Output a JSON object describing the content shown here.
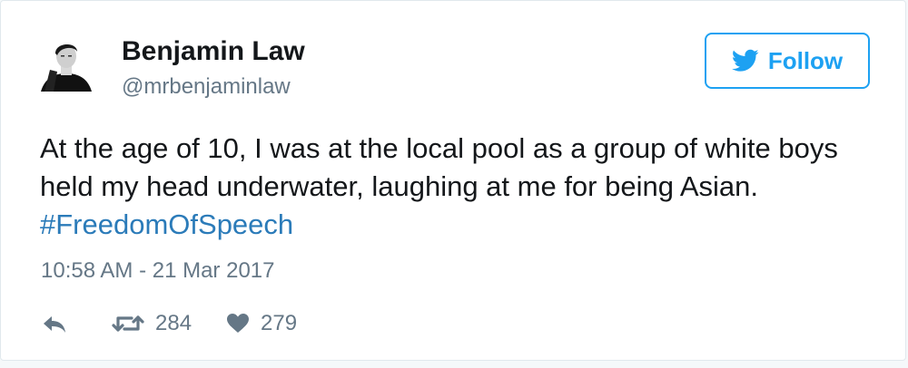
{
  "tweet": {
    "author": {
      "name": "Benjamin Law",
      "handle": "@mrbenjaminlaw",
      "avatar_icon": "profile-photo"
    },
    "follow_button": {
      "label": "Follow",
      "icon": "twitter-bird-icon"
    },
    "text_part1": "At the age of 10, I was at the local pool as a group of white boys held my head underwater, laughing at me for being Asian.",
    "hashtag": "#FreedomOfSpeech",
    "timestamp": "10:58 AM - 21 Mar 2017",
    "actions": {
      "reply_icon": "reply-icon",
      "retweet_icon": "retweet-icon",
      "retweet_count": "284",
      "like_icon": "heart-icon",
      "like_count": "279"
    },
    "colors": {
      "accent": "#1da1f2",
      "hashtag": "#2b7bb9",
      "muted": "#657786",
      "text": "#14171a"
    }
  }
}
